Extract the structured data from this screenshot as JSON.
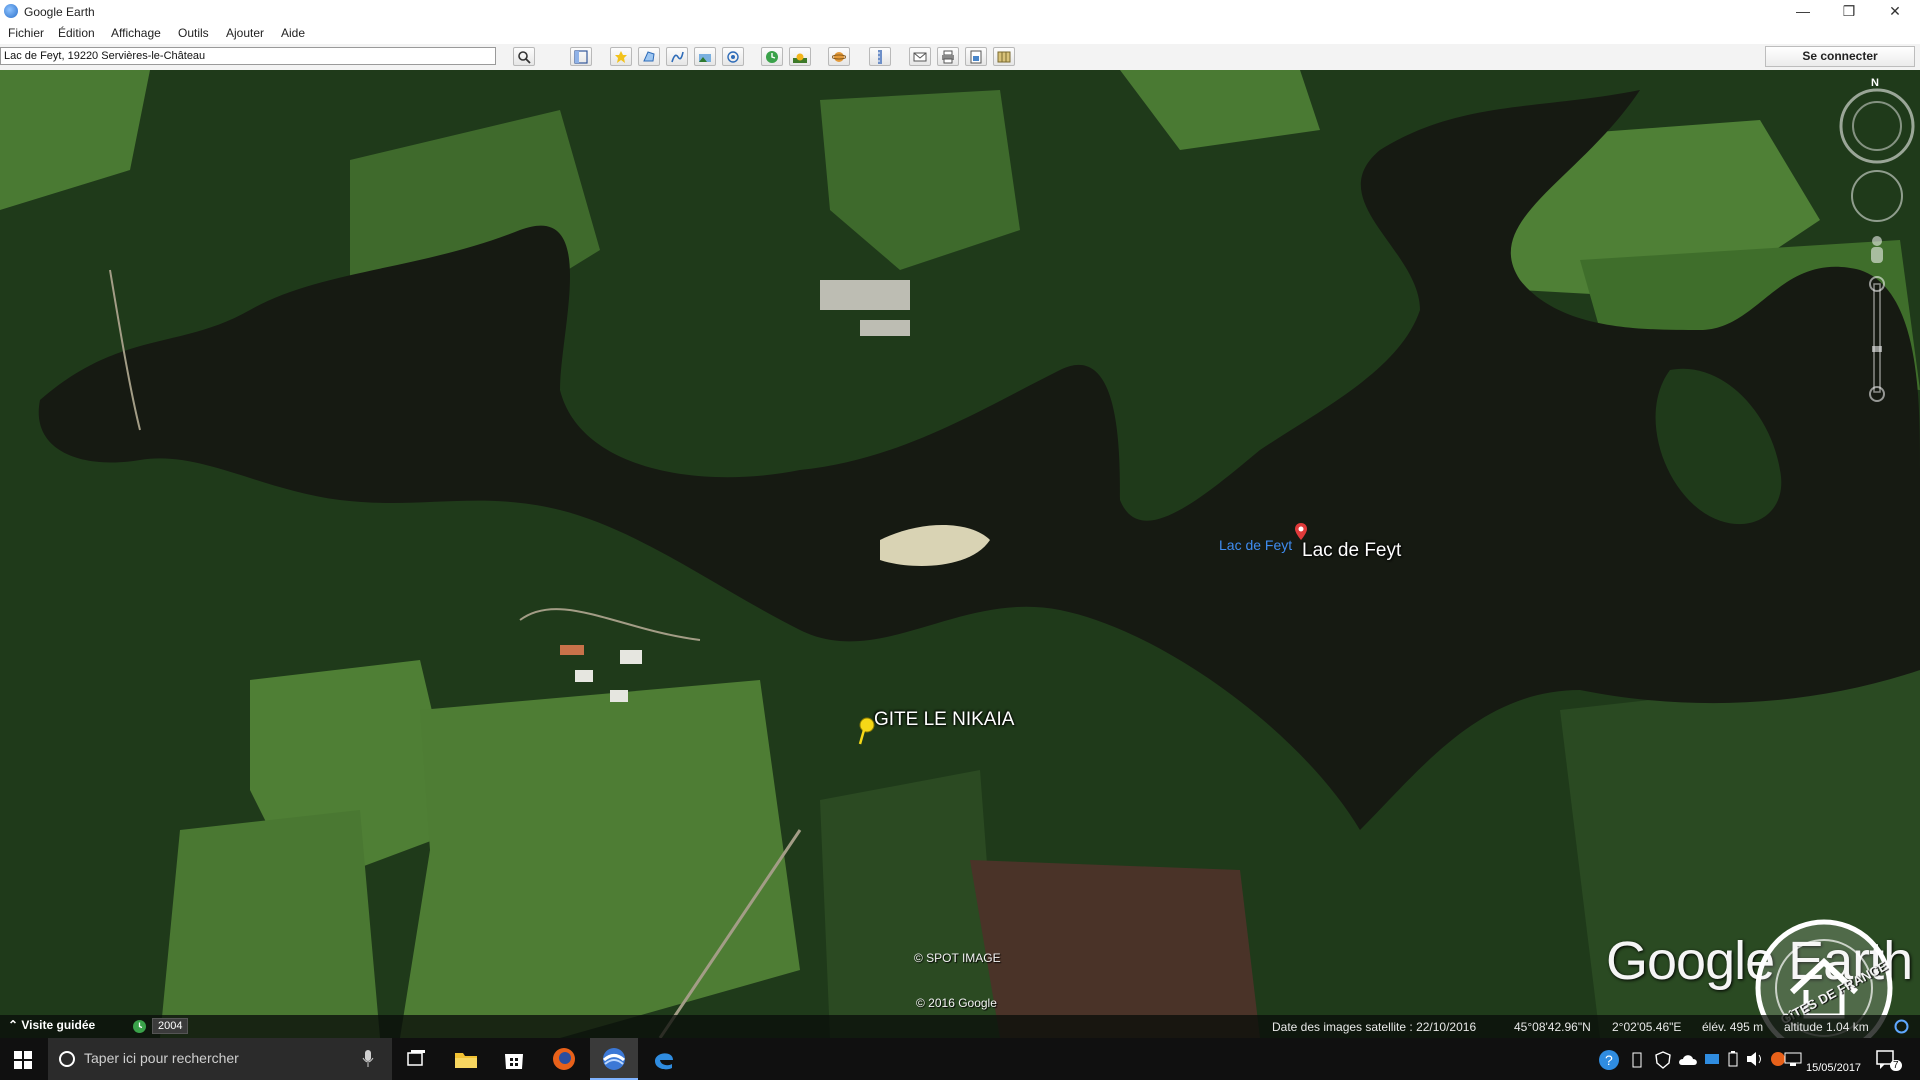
{
  "window": {
    "title": "Google Earth",
    "minimize_glyph": "—",
    "maximize_glyph": "❒",
    "close_glyph": "✕"
  },
  "menu": {
    "items": [
      "Fichier",
      "Édition",
      "Affichage",
      "Outils",
      "Ajouter",
      "Aide"
    ]
  },
  "toolbar": {
    "search_value": "Lac de Feyt, 19220 Servières-le-Château",
    "login_label": "Se connecter"
  },
  "map": {
    "place_label": "Lac de Feyt",
    "place_label_blue": "Lac de Feyt",
    "pushpin_label": "GITE LE NIKAIA",
    "compass_letter": "N",
    "attribution_spot": "© SPOT IMAGE",
    "attribution_google": "© 2016 Google",
    "logo_text": "Google Earth",
    "watermark_text": "GîTES DE FRANCE"
  },
  "status": {
    "tour_label": "Visite guidée",
    "year": "2004",
    "imagery_date": "Date des images satellite : 22/10/2016",
    "latitude": "45°08'42.96\"N",
    "longitude": "2°02'05.46\"E",
    "elevation": "élév.  495 m",
    "altitude": "altitude  1.04 km"
  },
  "taskbar": {
    "search_placeholder": "Taper ici pour rechercher",
    "date": "15/05/2017",
    "notification_count": "7"
  },
  "colors": {
    "water": "#161a12",
    "forest": "#1f3a1a",
    "meadow": "#4e7d34",
    "field_brown": "#4a3328",
    "accent_blue": "#3f8cf0"
  }
}
